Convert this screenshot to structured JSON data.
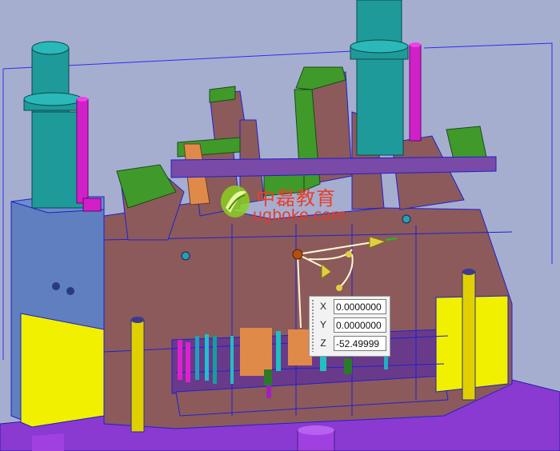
{
  "watermark": {
    "cn_text": "中磊教育",
    "url_text": "ugboke.com",
    "logo_icon": "green-leaf-logo-icon"
  },
  "coordinates": {
    "x_label": "X",
    "x_value": "0.0000000",
    "y_label": "Y",
    "y_value": "0.0000000",
    "z_label": "Z",
    "z_value": "-52.49999"
  },
  "colors": {
    "background": "#a6aed0",
    "mold_plate": "#8c5a5a",
    "edge": "#2a2ad0",
    "side_plate": "#5f7fc0",
    "guide_pillar": "#1f9a9a",
    "ejector_pin": "#d020c8",
    "slider": "#3f9a2a",
    "support": "#f0f000",
    "base": "#8a3ad0",
    "manipulator_handle": "#e0d040"
  }
}
